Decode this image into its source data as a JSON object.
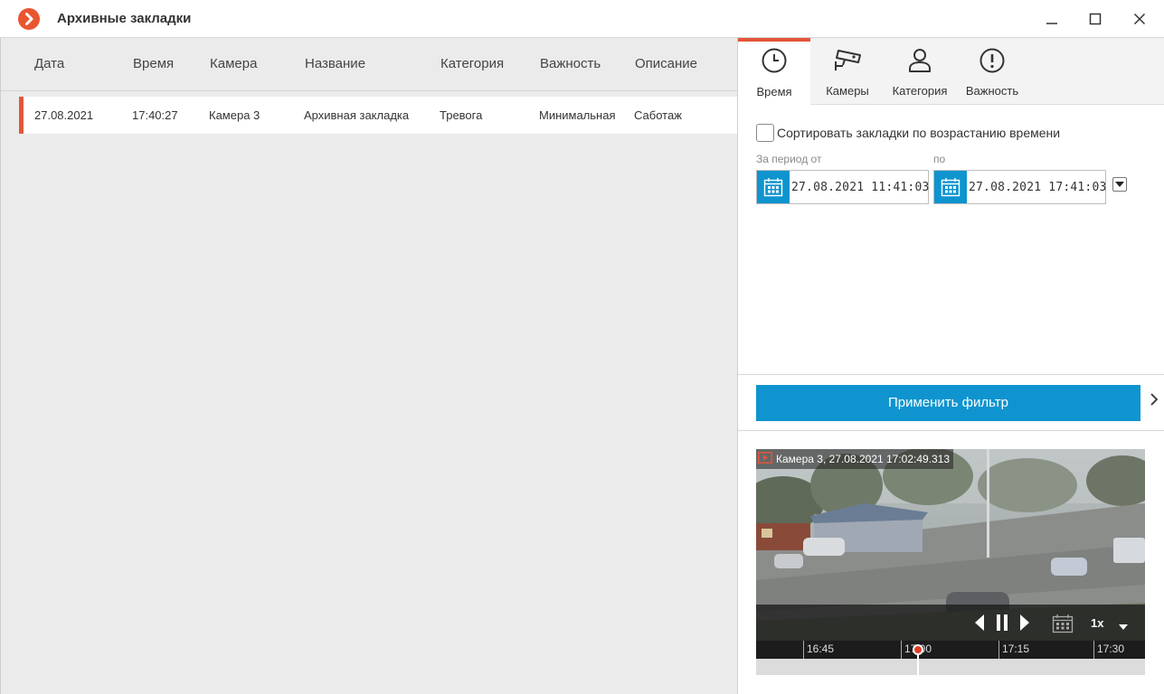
{
  "window": {
    "title": "Архивные закладки"
  },
  "table": {
    "columns": [
      "Дата",
      "Время",
      "Камера",
      "Название",
      "Категория",
      "Важность",
      "Описание"
    ],
    "rows": [
      {
        "date": "27.08.2021",
        "time": "17:40:27",
        "camera": "Камера 3",
        "name": "Архивная закладка",
        "category": "Тревога",
        "importance": "Минимальная",
        "description": "Саботаж"
      }
    ],
    "row_marker_color": "#e4553a"
  },
  "tabs": [
    {
      "label": "Время",
      "icon": "clock-icon",
      "active": true
    },
    {
      "label": "Камеры",
      "icon": "camera-icon",
      "active": false
    },
    {
      "label": "Категория",
      "icon": "person-icon",
      "active": false
    },
    {
      "label": "Важность",
      "icon": "exclamation-icon",
      "active": false
    }
  ],
  "filter": {
    "sort_checkbox_label": "Сортировать закладки по возрастанию времени",
    "sort_checked": false,
    "from_label": "За период от",
    "to_label": "по",
    "from_value": "27.08.2021  11:41:03",
    "to_value": "27.08.2021  17:41:03",
    "apply_label": "Применить фильтр"
  },
  "player": {
    "caption": "Камера 3, 27.08.2021 17:02:49.313",
    "speed": "1x",
    "timeline_labels": [
      "16:45",
      "17:00",
      "17:15",
      "17:30"
    ]
  },
  "colors": {
    "accent": "#e4553a",
    "primary": "#0f94cf"
  }
}
